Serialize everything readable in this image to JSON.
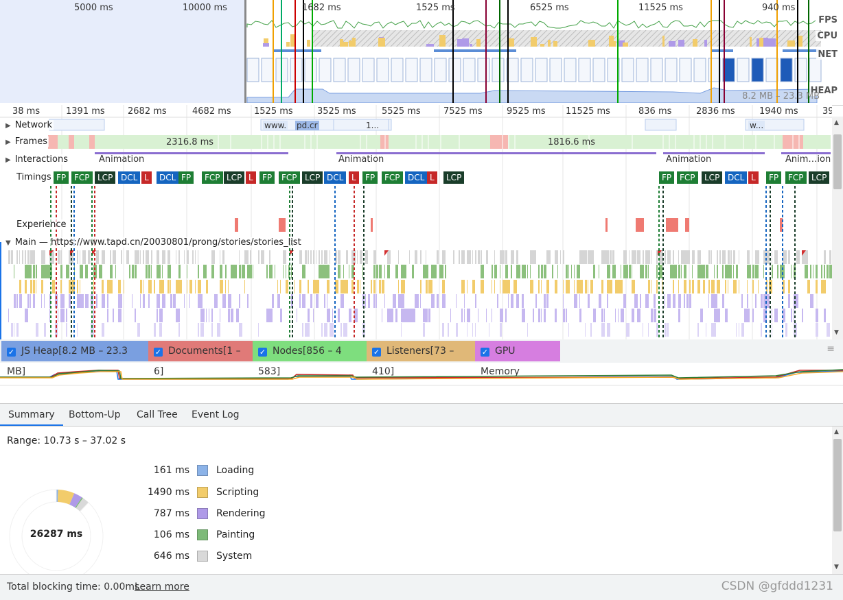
{
  "overview": {
    "ticks": [
      "5000 ms",
      "10000 ms",
      "1682 ms",
      "1525 ms",
      "6525 ms",
      "11525 ms",
      "940 ms"
    ],
    "labels": [
      "FPS",
      "CPU",
      "NET",
      "HEAP"
    ],
    "heap_range": "8.2 MB – 23.3 MB"
  },
  "timeline": {
    "ticks": [
      "38 ms",
      "1391 ms",
      "2682 ms",
      "4682 ms",
      "1525 ms",
      "3525 ms",
      "5525 ms",
      "7525 ms",
      "9525 ms",
      "11525 ms",
      "836 ms",
      "2836 ms",
      "1940 ms",
      "39"
    ],
    "tracks": {
      "network": "Network",
      "frames": "Frames",
      "interactions": "Interactions",
      "timings": "Timings",
      "experience": "Experience",
      "main": "Main — https://www.tapd.cn/20030801/prong/stories/stories_list"
    },
    "network_labels": [
      "www.",
      "pd.cr",
      "1...",
      "w..."
    ],
    "frame_durations": [
      "2316.8 ms",
      "1816.6 ms"
    ],
    "interaction_labels": [
      "Animation",
      "Animation",
      "Animation",
      "Anim…ion"
    ],
    "timing_markers": [
      "FP",
      "FCP",
      "LCP",
      "DCL",
      "L",
      "DCL",
      "FP",
      "FCP",
      "LCP",
      "L",
      "FP",
      "FCP",
      "LCP",
      "DCL",
      "L",
      "FP",
      "FCP",
      "DCL",
      "L",
      "LCP",
      "FP",
      "FCP",
      "LCP",
      "DCL",
      "L",
      "FP",
      "FCP",
      "LCP"
    ],
    "marker_colors": {
      "FP": "#1e7e34",
      "FCP": "#1e7e34",
      "LCP": "#1a3d2a",
      "DCL": "#1565c0",
      "L": "#c62828"
    }
  },
  "memory_legend": [
    {
      "label": "JS Heap[8.2 MB – 23.3 MB]",
      "color": "#7a9fe0"
    },
    {
      "label": "Documents[1 – 6]",
      "color": "#e07a78"
    },
    {
      "label": "Nodes[856 – 4 583]",
      "color": "#7ede7e"
    },
    {
      "label": "Listeners[73 – 410]",
      "color": "#e0b878"
    },
    {
      "label": "GPU Memory",
      "color": "#d67ee0"
    }
  ],
  "tabs": [
    "Summary",
    "Bottom-Up",
    "Call Tree",
    "Event Log"
  ],
  "summary": {
    "range": "Range: 10.73 s – 37.02 s",
    "total": "26287 ms",
    "rows": [
      {
        "value": "161 ms",
        "name": "Loading",
        "color": "#8cb3e8"
      },
      {
        "value": "1490 ms",
        "name": "Scripting",
        "color": "#f2cc6b"
      },
      {
        "value": "787 ms",
        "name": "Rendering",
        "color": "#af9ae8"
      },
      {
        "value": "106 ms",
        "name": "Painting",
        "color": "#7dba78"
      },
      {
        "value": "646 ms",
        "name": "System",
        "color": "#d9d9d9"
      }
    ],
    "chart_ms": [
      161,
      1490,
      787,
      106,
      646,
      23097
    ]
  },
  "footer": {
    "blocking": "Total blocking time: 0.00ms",
    "learn_more": "Learn more",
    "watermark": "CSDN @gfddd1231"
  }
}
